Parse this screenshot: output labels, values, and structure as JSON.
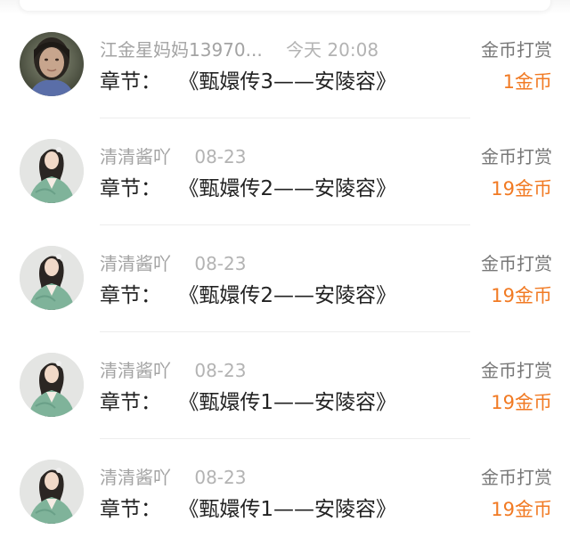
{
  "records": [
    {
      "name": "江金星妈妈13970...",
      "time": "今天 20:08",
      "chapter_label": "章节：",
      "chapter_title": "《甄嬛传3——安陵容》",
      "type": "金币打赏",
      "amount": "1金币",
      "avatar": "photo-avatar"
    },
    {
      "name": "清清酱吖",
      "time": "08-23",
      "chapter_label": "章节：",
      "chapter_title": "《甄嬛传2——安陵容》",
      "type": "金币打赏",
      "amount": "19金币",
      "avatar": "illustrated-woman-avatar"
    },
    {
      "name": "清清酱吖",
      "time": "08-23",
      "chapter_label": "章节：",
      "chapter_title": "《甄嬛传2——安陵容》",
      "type": "金币打赏",
      "amount": "19金币",
      "avatar": "illustrated-woman-avatar"
    },
    {
      "name": "清清酱吖",
      "time": "08-23",
      "chapter_label": "章节：",
      "chapter_title": "《甄嬛传1——安陵容》",
      "type": "金币打赏",
      "amount": "19金币",
      "avatar": "illustrated-woman-avatar"
    },
    {
      "name": "清清酱吖",
      "time": "08-23",
      "chapter_label": "章节：",
      "chapter_title": "《甄嬛传1——安陵容》",
      "type": "金币打赏",
      "amount": "19金币",
      "avatar": "illustrated-woman-avatar"
    }
  ],
  "colors": {
    "amount": "#f17a23",
    "name": "#a3a3a3",
    "chapter": "#222222",
    "type": "#777777",
    "divider": "#ededed"
  }
}
